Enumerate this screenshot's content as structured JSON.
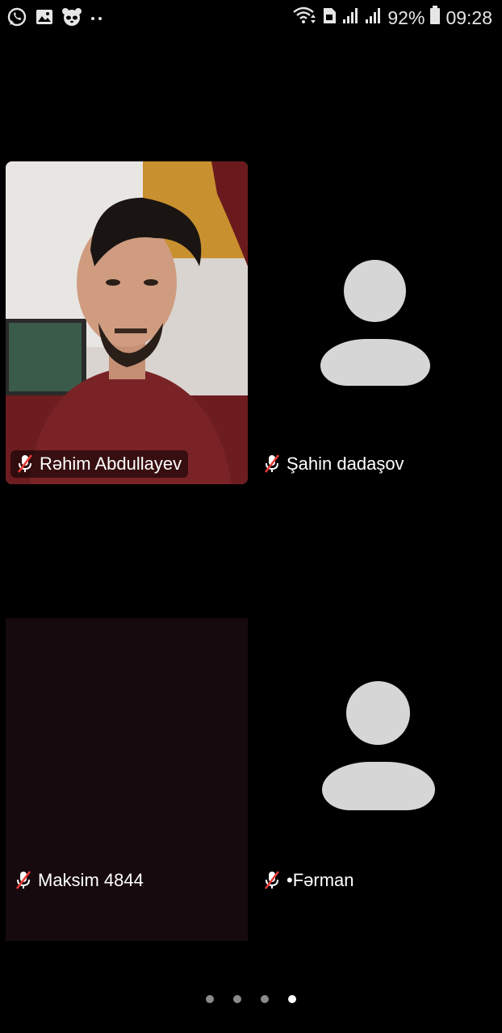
{
  "status_bar": {
    "battery": "92%",
    "time": "09:28",
    "left_icons": [
      "whatsapp-icon",
      "gallery-icon",
      "panda-icon",
      "more-notifications-icon"
    ],
    "right_icons": [
      "wifi-icon",
      "sim-icon",
      "signal-1-icon",
      "signal-2-icon",
      "battery-icon"
    ]
  },
  "participants": [
    {
      "name": "Rəhim Abdullayev",
      "muted": true,
      "video": true
    },
    {
      "name": "Şahin dadaşov",
      "muted": true,
      "video": false
    },
    {
      "name": "Maksim 4844",
      "muted": true,
      "video": "dark"
    },
    {
      "name": "•Fərman",
      "muted": true,
      "video": false
    }
  ],
  "pager": {
    "pages": 4,
    "current": 4
  },
  "colors": {
    "background": "#000000",
    "avatar": "#d6d6d6",
    "mute_slash": "#e53935"
  }
}
